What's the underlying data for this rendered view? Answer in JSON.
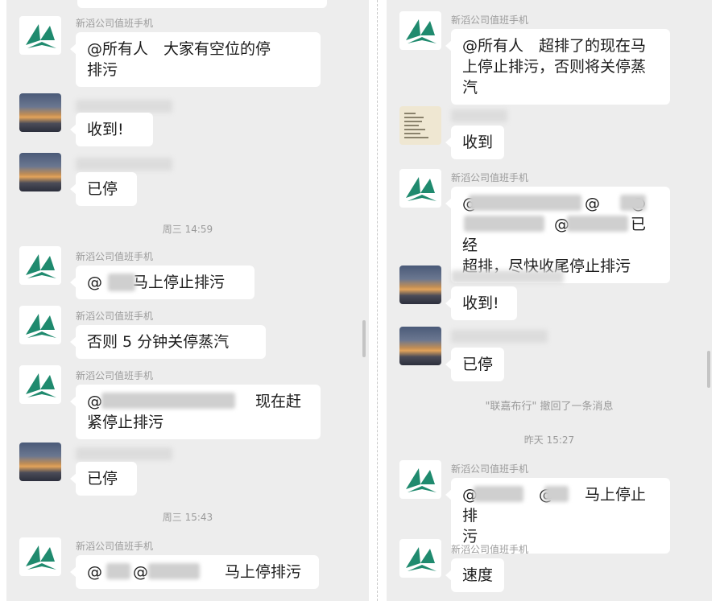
{
  "left": {
    "messages": [
      {
        "sender": "新滔公司值班手机",
        "avatar": "logo",
        "text": "@所有人　大家有空位的停\n排污"
      },
      {
        "sender": "",
        "avatar": "sunset",
        "text": "收到!"
      },
      {
        "sender": "",
        "avatar": "sunset",
        "text": "已停"
      },
      {
        "timestamp": "周三 14:59"
      },
      {
        "sender": "新滔公司值班手机",
        "avatar": "logo",
        "text": "@　　马上停止排污"
      },
      {
        "sender": "新滔公司值班手机",
        "avatar": "logo",
        "text": "否则 5 分钟关停蒸汽"
      },
      {
        "sender": "新滔公司值班手机",
        "avatar": "logo",
        "text": "@　　　　　　　　　　现在赶\n紧停止排污"
      },
      {
        "sender": "",
        "avatar": "sunset",
        "text": "已停"
      },
      {
        "timestamp": "周三 15:43"
      },
      {
        "sender": "新滔公司值班手机",
        "avatar": "logo",
        "text": "@　　@　　　　　马上停排污"
      }
    ]
  },
  "right": {
    "messages": [
      {
        "sender": "新滔公司值班手机",
        "avatar": "logo",
        "text": "@所有人　超排了的现在马\n上停止排污，否则将关停蒸\n汽"
      },
      {
        "sender": "",
        "avatar": "note",
        "text": "收到"
      },
      {
        "sender": "新滔公司值班手机",
        "avatar": "logo",
        "text": "@　　　　　　　@　　@\n　　　　　　@　　　　已经\n超排，尽快收尾停止排污"
      },
      {
        "sender": "",
        "avatar": "sunset",
        "text": "收到!"
      },
      {
        "sender": "",
        "avatar": "sunset",
        "text": "已停"
      },
      {
        "system": "\"联嘉布行\" 撤回了一条消息"
      },
      {
        "timestamp": "昨天 15:27"
      },
      {
        "sender": "新滔公司值班手机",
        "avatar": "logo",
        "text": "@　　　　@　　马上停止排\n污"
      },
      {
        "sender": "新滔公司值班手机",
        "avatar": "logo",
        "text": "速度"
      }
    ]
  },
  "colors": {
    "chat_bg": "#ededed",
    "bubble": "#ffffff",
    "logo_green": "#1f8a6e"
  }
}
